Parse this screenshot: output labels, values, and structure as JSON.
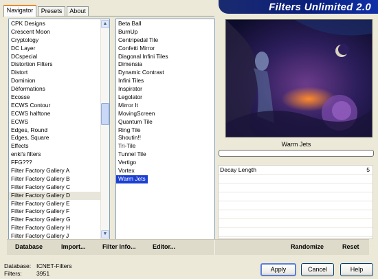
{
  "tabs": [
    {
      "label": "Navigator"
    },
    {
      "label": "Presets"
    },
    {
      "label": "About"
    }
  ],
  "app_title": "Filters Unlimited 2.0",
  "categories": [
    "CPK Designs",
    "Crescent Moon",
    "Cryptology",
    "DC Layer",
    "DCspecial",
    "Distortion Filters",
    "Distort",
    "Dominion",
    "Déformations",
    "Ecosse",
    "ECWS Contour",
    "ECWS halftone",
    "ECWS",
    "Edges, Round",
    "Edges, Square",
    "Effects",
    "enki's filters",
    "FFG???",
    "Filter Factory Gallery A",
    "Filter Factory Gallery B",
    "Filter Factory Gallery C",
    "Filter Factory Gallery D",
    "Filter Factory Gallery E",
    "Filter Factory Gallery F",
    "Filter Factory Gallery G",
    "Filter Factory Gallery H",
    "Filter Factory Gallery J"
  ],
  "highlighted_category": "Filter Factory Gallery D",
  "filters": [
    "Beta Ball",
    "BurnUp",
    "Centripedal Tile",
    "Confetti Mirror",
    "Diagonal Infini Tiles",
    "Dimensia",
    "Dynamic Contrast",
    "Infini Tiles",
    "Inspirator",
    "Legolator",
    "Mirror It",
    "MovingScreen",
    "Quantum Tile",
    "Ring Tile",
    "Shoutin!!",
    "Tri-Tile",
    "Tunnel Tile",
    "Vertigo",
    "Vortex",
    "Warm Jets"
  ],
  "selected_filter": "Warm Jets",
  "preview_caption": "Warm Jets",
  "parameters": [
    {
      "name": "Decay Length",
      "value": "5"
    }
  ],
  "toolbar": {
    "database": "Database",
    "import": "Import...",
    "filter_info": "Filter Info...",
    "editor": "Editor...",
    "randomize": "Randomize",
    "reset": "Reset"
  },
  "footer": {
    "database_label": "Database:",
    "database_value": "ICNET-Filters",
    "filters_label": "Filters:",
    "filters_value": "3951"
  },
  "buttons": {
    "apply": "Apply",
    "cancel": "Cancel",
    "help": "Help"
  },
  "icons": {
    "scroll_up": "scroll-up-arrow-icon",
    "scroll_down": "scroll-down-arrow-icon"
  }
}
